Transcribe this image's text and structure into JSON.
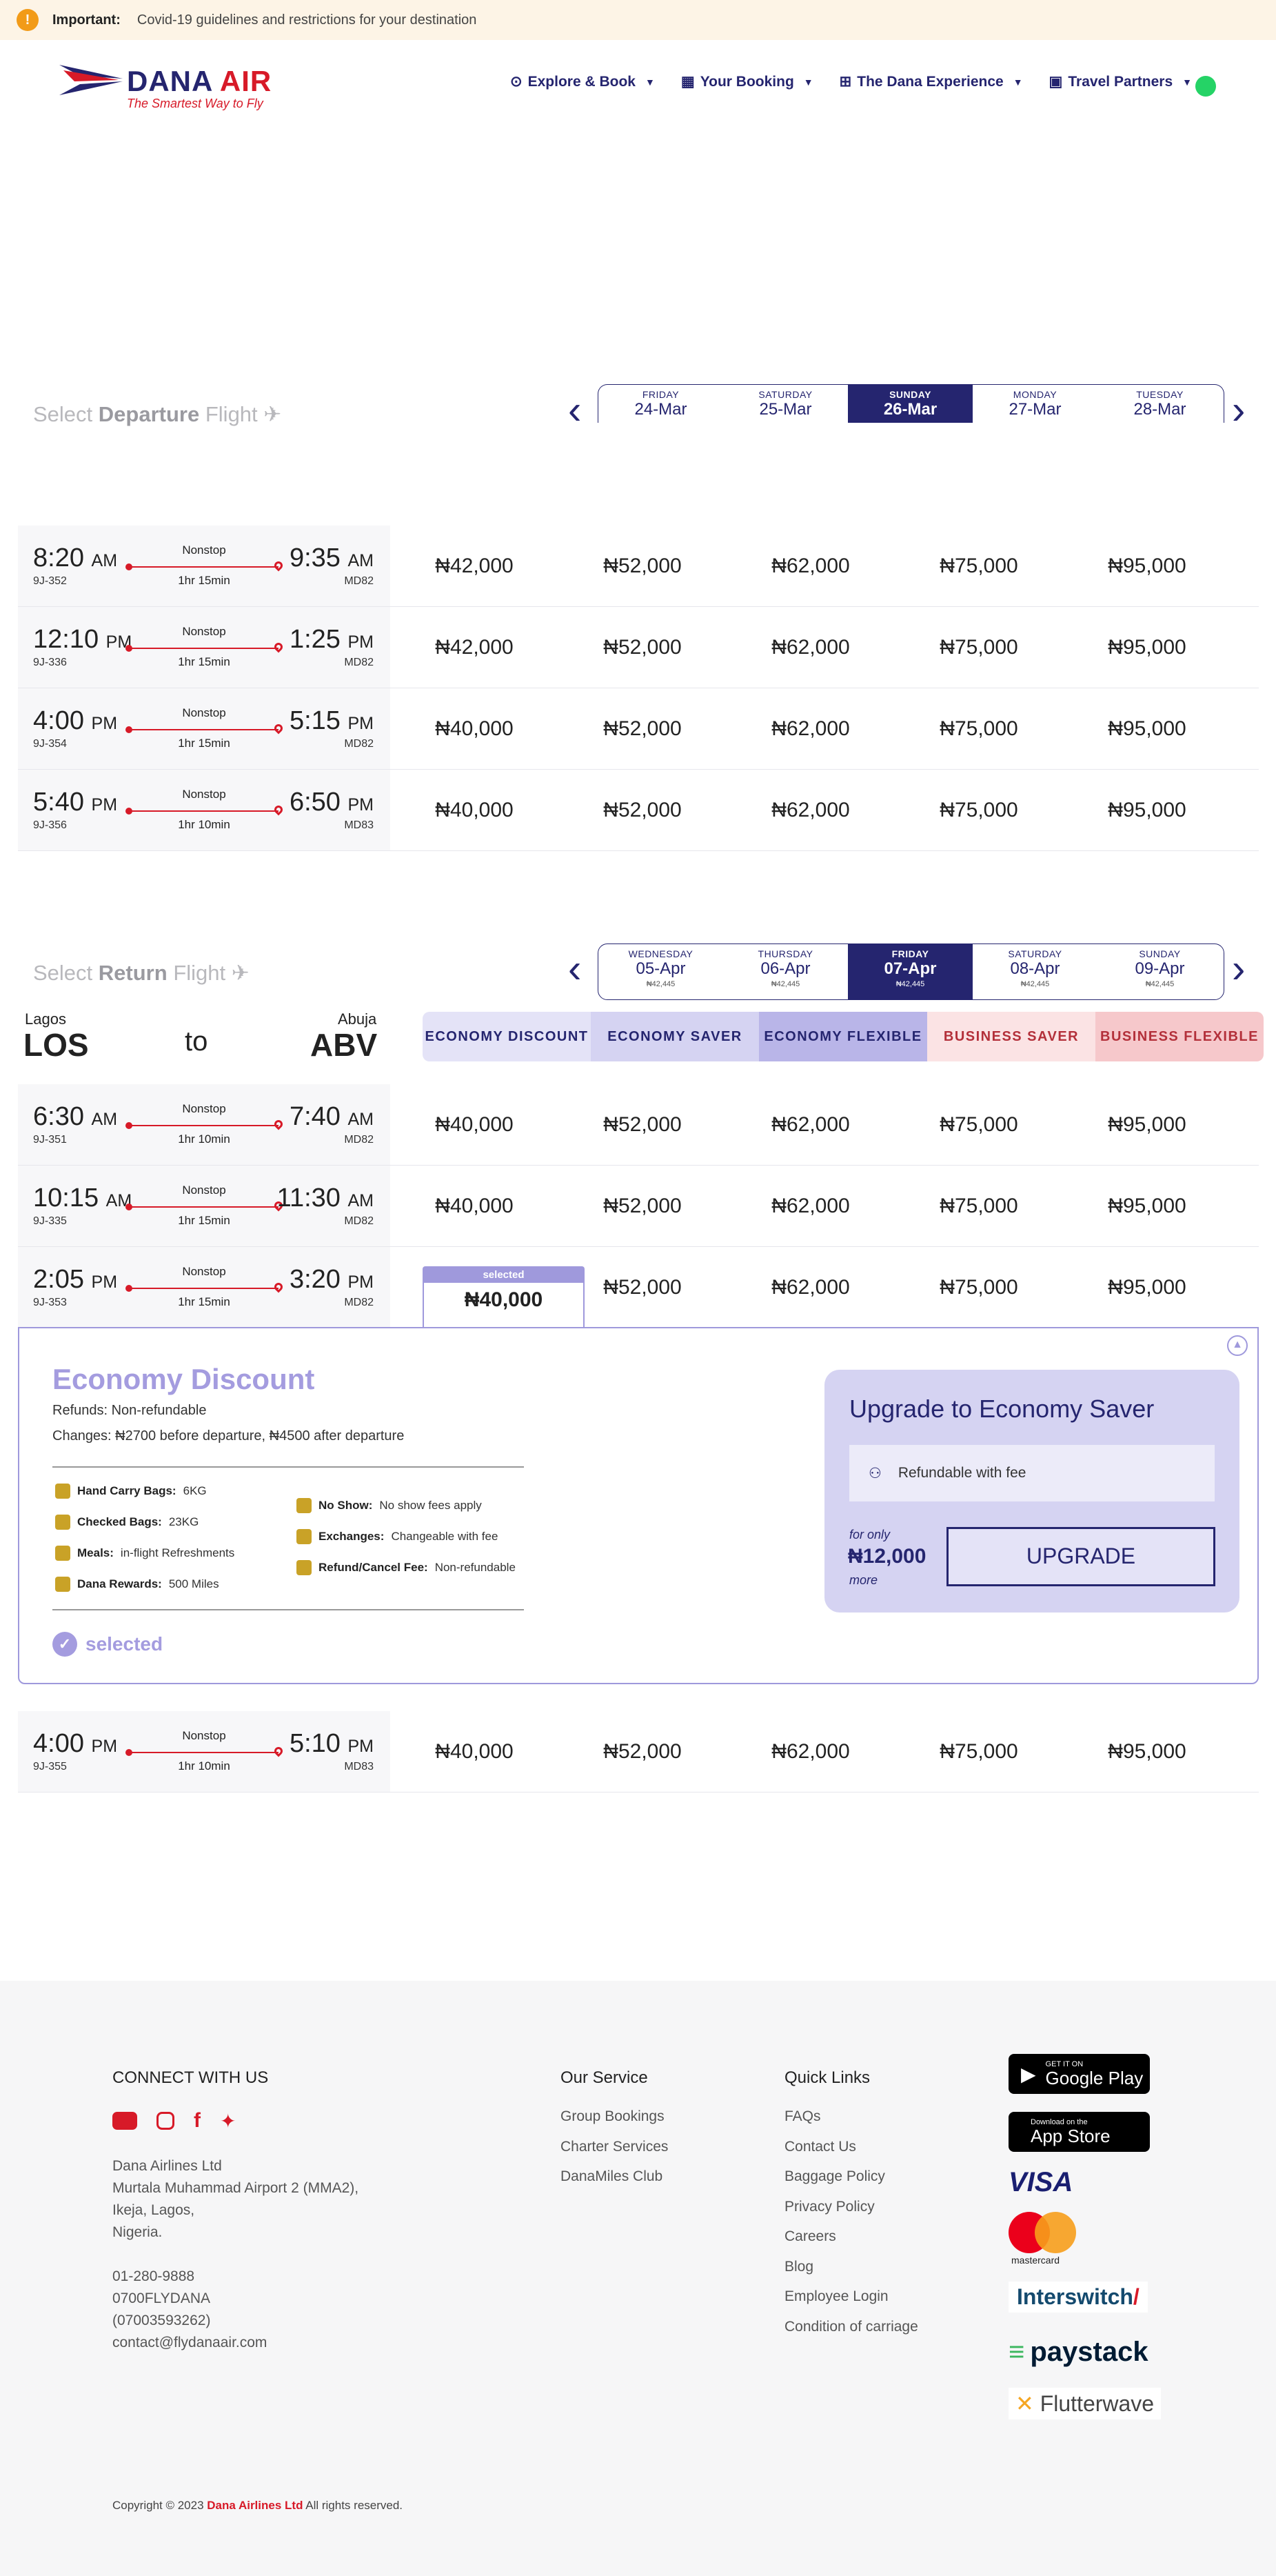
{
  "banner": {
    "important_label": "Important:",
    "text": "Covid-19 guidelines and restrictions for your destination"
  },
  "logo": {
    "name_part1": "DANA",
    "name_part2": "AIR",
    "tagline": "The Smartest Way to Fly"
  },
  "nav": [
    {
      "label": "Explore & Book",
      "icon": "binoculars-icon"
    },
    {
      "label": "Your Booking",
      "icon": "calendar-icon"
    },
    {
      "label": "The Dana Experience",
      "icon": "grid-icon"
    },
    {
      "label": "Travel Partners",
      "icon": "briefcase-icon"
    }
  ],
  "departure": {
    "heading_pre": "Select",
    "heading_bold": "Departure",
    "heading_post": "Flight",
    "dates": [
      {
        "day": "FRIDAY",
        "date": "24-Mar"
      },
      {
        "day": "SATURDAY",
        "date": "25-Mar"
      },
      {
        "day": "SUNDAY",
        "date": "26-Mar",
        "active": true
      },
      {
        "day": "MONDAY",
        "date": "27-Mar"
      },
      {
        "day": "TUESDAY",
        "date": "28-Mar"
      }
    ],
    "flights": [
      {
        "dep": "8:20",
        "dep_ampm": "AM",
        "fnum": "9J-352",
        "stop": "Nonstop",
        "dur": "1hr 15min",
        "arr": "9:35",
        "arr_ampm": "AM",
        "ac": "MD82",
        "prices": [
          "₦42,000",
          "₦52,000",
          "₦62,000",
          "₦75,000",
          "₦95,000"
        ]
      },
      {
        "dep": "12:10",
        "dep_ampm": "PM",
        "fnum": "9J-336",
        "stop": "Nonstop",
        "dur": "1hr 15min",
        "arr": "1:25",
        "arr_ampm": "PM",
        "ac": "MD82",
        "prices": [
          "₦42,000",
          "₦52,000",
          "₦62,000",
          "₦75,000",
          "₦95,000"
        ]
      },
      {
        "dep": "4:00",
        "dep_ampm": "PM",
        "fnum": "9J-354",
        "stop": "Nonstop",
        "dur": "1hr 15min",
        "arr": "5:15",
        "arr_ampm": "PM",
        "ac": "MD82",
        "prices": [
          "₦40,000",
          "₦52,000",
          "₦62,000",
          "₦75,000",
          "₦95,000"
        ]
      },
      {
        "dep": "5:40",
        "dep_ampm": "PM",
        "fnum": "9J-356",
        "stop": "Nonstop",
        "dur": "1hr 10min",
        "arr": "6:50",
        "arr_ampm": "PM",
        "ac": "MD83",
        "prices": [
          "₦40,000",
          "₦52,000",
          "₦62,000",
          "₦75,000",
          "₦95,000"
        ]
      }
    ]
  },
  "return": {
    "heading_pre": "Select",
    "heading_bold": "Return",
    "heading_post": "Flight",
    "dates": [
      {
        "day": "WEDNESDAY",
        "date": "05-Apr",
        "price": "₦42,445"
      },
      {
        "day": "THURSDAY",
        "date": "06-Apr",
        "price": "₦42,445"
      },
      {
        "day": "FRIDAY",
        "date": "07-Apr",
        "price": "₦42,445",
        "active": true
      },
      {
        "day": "SATURDAY",
        "date": "08-Apr",
        "price": "₦42,445"
      },
      {
        "day": "SUNDAY",
        "date": "09-Apr",
        "price": "₦42,445"
      }
    ],
    "route": {
      "from_city": "Lagos",
      "from_code": "LOS",
      "to_word": "to",
      "to_city": "Abuja",
      "to_code": "ABV"
    },
    "fare_headers": [
      {
        "label": "ECONOMY DISCOUNT",
        "bg": "#e4e3f7",
        "color": "#25256f"
      },
      {
        "label": "ECONOMY SAVER",
        "bg": "#d5d3f2",
        "color": "#25256f"
      },
      {
        "label": "ECONOMY FLEXIBLE",
        "bg": "#b9b5e8",
        "color": "#25256f"
      },
      {
        "label": "BUSINESS SAVER",
        "bg": "#fbe3e4",
        "color": "#b3303a"
      },
      {
        "label": "BUSINESS FLEXIBLE",
        "bg": "#f6c8cb",
        "color": "#b3303a"
      }
    ],
    "flights": [
      {
        "dep": "6:30",
        "dep_ampm": "AM",
        "fnum": "9J-351",
        "stop": "Nonstop",
        "dur": "1hr 10min",
        "arr": "7:40",
        "arr_ampm": "AM",
        "ac": "MD82",
        "prices": [
          "₦40,000",
          "₦52,000",
          "₦62,000",
          "₦75,000",
          "₦95,000"
        ]
      },
      {
        "dep": "10:15",
        "dep_ampm": "AM",
        "fnum": "9J-335",
        "stop": "Nonstop",
        "dur": "1hr 15min",
        "arr": "11:30",
        "arr_ampm": "AM",
        "ac": "MD82",
        "prices": [
          "₦40,000",
          "₦52,000",
          "₦62,000",
          "₦75,000",
          "₦95,000"
        ]
      },
      {
        "dep": "2:05",
        "dep_ampm": "PM",
        "fnum": "9J-353",
        "stop": "Nonstop",
        "dur": "1hr 15min",
        "arr": "3:20",
        "arr_ampm": "PM",
        "ac": "MD82",
        "prices": [
          "",
          "₦52,000",
          "₦62,000",
          "₦75,000",
          "₦95,000"
        ]
      },
      {
        "dep": "4:00",
        "dep_ampm": "PM",
        "fnum": "9J-355",
        "stop": "Nonstop",
        "dur": "1hr 10min",
        "arr": "5:10",
        "arr_ampm": "PM",
        "ac": "MD83",
        "prices": [
          "₦40,000",
          "₦52,000",
          "₦62,000",
          "₦75,000",
          "₦95,000"
        ]
      }
    ],
    "selected_fare": {
      "tag": "selected",
      "price": "₦40,000"
    }
  },
  "details": {
    "title": "Economy Discount",
    "refunds": "Refunds: Non-refundable",
    "changes": "Changes: ₦2700 before departure, ₦4500 after departure",
    "features_left": [
      {
        "label": "Hand Carry Bags:",
        "value": "6KG",
        "icon": "bag-icon"
      },
      {
        "label": "Checked Bags:",
        "value": "23KG",
        "icon": "luggage-icon"
      },
      {
        "label": "Meals:",
        "value": "in-flight Refreshments",
        "icon": "apple-icon"
      },
      {
        "label": "Dana Rewards:",
        "value": "500 Miles",
        "icon": "trophy-icon"
      }
    ],
    "features_right": [
      {
        "label": "No Show:",
        "value": "No show fees apply",
        "icon": "info-icon"
      },
      {
        "label": "Exchanges:",
        "value": "Changeable with fee",
        "icon": "ticket-icon"
      },
      {
        "label": "Refund/Cancel Fee:",
        "value": "Non-refundable",
        "icon": "handshake-icon"
      }
    ],
    "selected_label": "selected",
    "upgrade": {
      "title": "Upgrade to Economy Saver",
      "feature": "Refundable with fee",
      "for_only": "for only",
      "price": "₦12,000",
      "more": "more",
      "button": "UPGRADE"
    }
  },
  "footer": {
    "connect": "CONNECT WITH US",
    "address": [
      "Dana Airlines Ltd",
      "Murtala Muhammad Airport 2 (MMA2),",
      "Ikeja, Lagos,",
      "Nigeria."
    ],
    "contacts": [
      "01-280-9888",
      "0700FLYDANA",
      "(07003593262)",
      "contact@flydanaair.com"
    ],
    "our_service": {
      "title": "Our Service",
      "links": [
        "Group Bookings",
        "Charter Services",
        "DanaMiles Club"
      ]
    },
    "quick_links": {
      "title": "Quick Links",
      "links": [
        "FAQs",
        "Contact Us",
        "Baggage Policy",
        "Privacy Policy",
        "Careers",
        "Blog",
        "Employee Login",
        "Condition of carriage"
      ]
    },
    "google_play": {
      "top": "GET IT ON",
      "bottom": "Google Play"
    },
    "app_store": {
      "top": "Download on the",
      "bottom": "App Store"
    },
    "payments": {
      "visa": "VISA",
      "mastercard": "mastercard",
      "interswitch": "Interswitch",
      "paystack": "paystack",
      "flutterwave": "Flutterwave"
    },
    "copyright_pre": "Copyright © 2023",
    "copyright_brand": "Dana Airlines Ltd",
    "copyright_post": "All rights reserved."
  }
}
